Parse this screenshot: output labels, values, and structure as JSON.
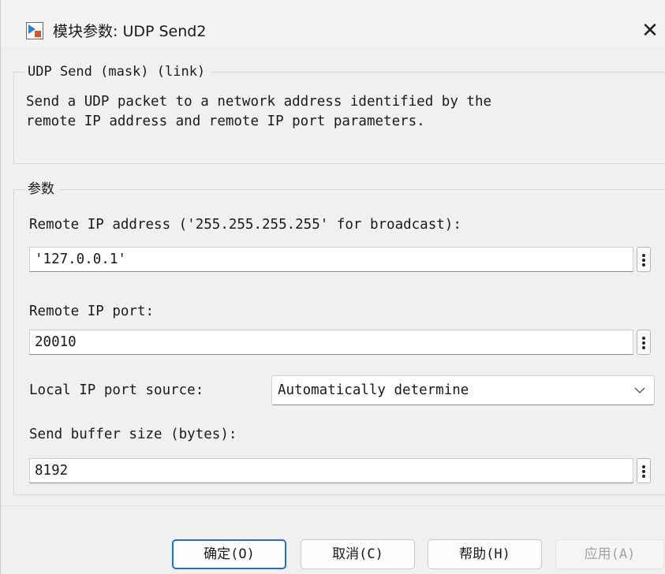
{
  "window": {
    "title": "模块参数: UDP Send2",
    "close_symbol": "✕"
  },
  "description_group": {
    "legend": "UDP Send (mask) (link)",
    "text": "Send a UDP packet to a network address identified by the\nremote IP address and remote IP port parameters."
  },
  "parameters_group": {
    "legend": "参数",
    "remote_ip_address": {
      "label": "Remote IP address ('255.255.255.255' for broadcast):",
      "value": "'127.0.0.1'"
    },
    "remote_ip_port": {
      "label": "Remote IP port:",
      "value": "20010"
    },
    "local_ip_port_source": {
      "label": "Local IP port source:",
      "selected": "Automatically determine"
    },
    "send_buffer_size": {
      "label": "Send buffer size (bytes):",
      "value": "8192"
    }
  },
  "buttons": {
    "ok": "确定(O)",
    "cancel": "取消(C)",
    "help": "帮助(H)",
    "apply": "应用(A)"
  },
  "colors": {
    "accent": "#1f6fd1",
    "background": "#f0f0f0"
  }
}
